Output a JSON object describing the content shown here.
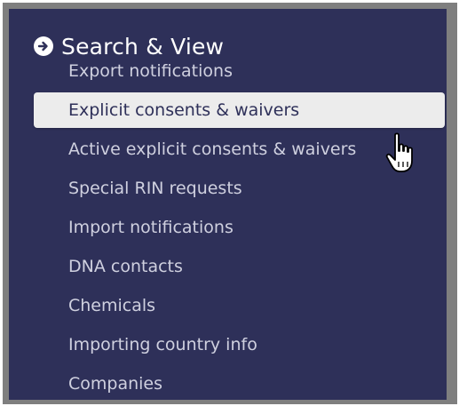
{
  "section": {
    "title": "Search & View",
    "icon": "circle-arrow-right-icon"
  },
  "menu": {
    "items": [
      {
        "label": "Export notifications",
        "active": false
      },
      {
        "label": "Explicit consents & waivers",
        "active": true
      },
      {
        "label": "Active explicit consents & waivers",
        "active": false
      },
      {
        "label": "Special RIN requests",
        "active": false
      },
      {
        "label": "Import notifications",
        "active": false
      },
      {
        "label": "DNA contacts",
        "active": false
      },
      {
        "label": "Chemicals",
        "active": false
      },
      {
        "label": "Importing country info",
        "active": false
      },
      {
        "label": "Companies",
        "active": false
      }
    ]
  },
  "colors": {
    "panel_background": "#2e3059",
    "frame_border": "#7f7f7f",
    "item_text": "#cfd0df",
    "active_background": "#ececec"
  },
  "cursor": "hand-pointer-icon"
}
